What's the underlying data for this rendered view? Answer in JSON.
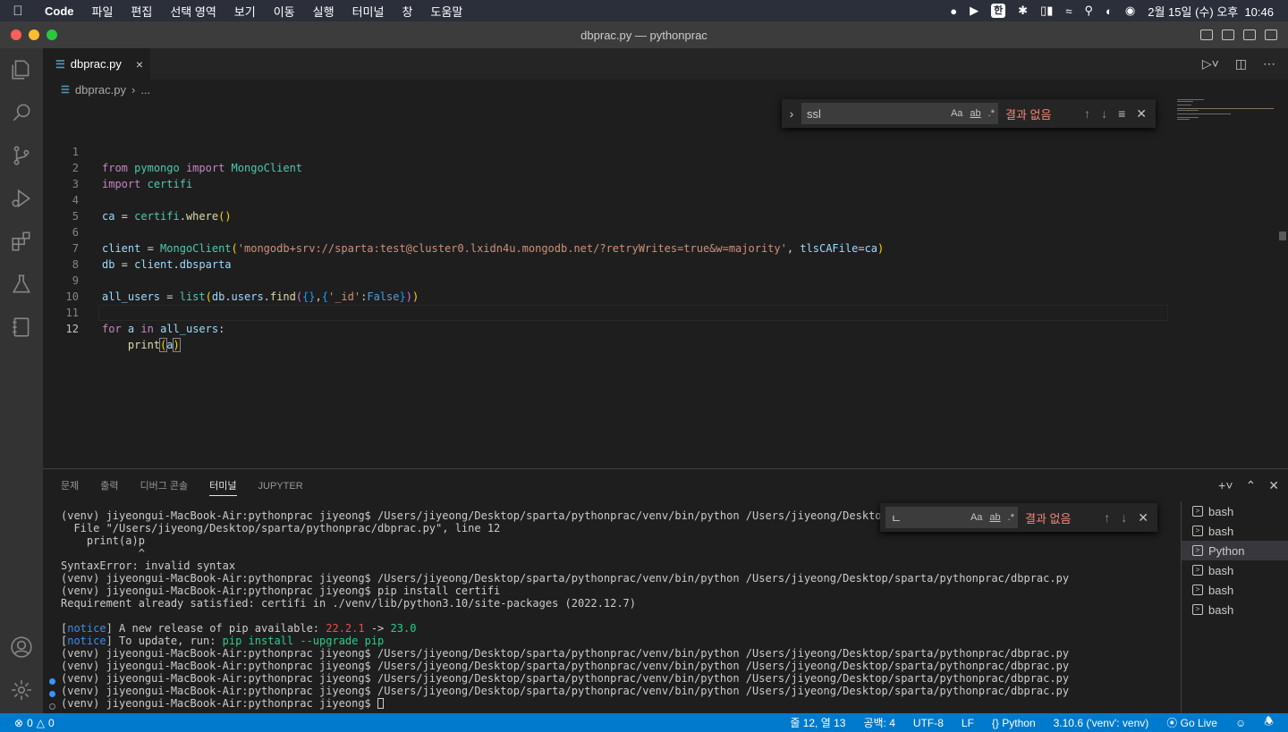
{
  "menubar": {
    "app": "Code",
    "items": [
      "파일",
      "편집",
      "선택 영역",
      "보기",
      "이동",
      "실행",
      "터미널",
      "창",
      "도움말"
    ],
    "input_method": "한",
    "datetime": "2월 15일 (수) 오후  10:46"
  },
  "window": {
    "title": "dbprac.py — pythonprac"
  },
  "tab": {
    "icon": "python-icon",
    "label": "dbprac.py",
    "close": "×"
  },
  "breadcrumb": {
    "file": "dbprac.py",
    "sep": "›",
    "more": "..."
  },
  "find": {
    "value": "ssl",
    "match_case": "Aa",
    "whole_word": "ab",
    "regex": ".*",
    "no_results": "결과 없음"
  },
  "code": {
    "active_line": 12,
    "lines": [
      {
        "n": "1"
      },
      {
        "n": "2"
      },
      {
        "n": "3"
      },
      {
        "n": "4"
      },
      {
        "n": "5"
      },
      {
        "n": "6"
      },
      {
        "n": "7"
      },
      {
        "n": "8"
      },
      {
        "n": "9"
      },
      {
        "n": "10"
      },
      {
        "n": "11"
      },
      {
        "n": "12"
      }
    ],
    "tokens": {
      "from": "from",
      "pymongo": "pymongo",
      "import": "import",
      "MongoClient": "MongoClient",
      "certifi": "certifi",
      "ca": "ca",
      "eq": " = ",
      "where": "where",
      "dot": ".",
      "paren_open": "(",
      "paren_close": ")",
      "client": "client",
      "conn_str": "'mongodb+srv://sparta:test@cluster0.lxidn4u.mongodb.net/?retryWrites=true&w=majority'",
      "comma_space": ", ",
      "tlsCAFile": "tlsCAFile",
      "assign": "=",
      "db": "db",
      "dbsparta": "dbsparta",
      "all_users": "all_users",
      "list": "list",
      "users": "users",
      "find": "find",
      "brace_open": "{",
      "brace_close": "}",
      "comma": ",",
      "id_key": "'_id'",
      "colon": ":",
      "False": "False",
      "for": "for",
      "a": "a",
      "in": "in",
      "print": "print",
      "indent": "    "
    }
  },
  "panel": {
    "tabs": [
      "문제",
      "출력",
      "디버그 콘솔",
      "터미널",
      "JUPYTER"
    ],
    "active_tab": "터미널",
    "find": {
      "value": "ㄴ",
      "no_results": "결과 없음"
    }
  },
  "terminal": {
    "lines": [
      "(venv) jiyeongui-MacBook-Air:pythonprac jiyeong$ /Users/jiyeong/Desktop/sparta/pythonprac/venv/bin/python /Users/jiyeong/Desktop/sp",
      "  File \"/Users/jiyeong/Desktop/sparta/pythonprac/dbprac.py\", line 12",
      "    print(a)p",
      "            ^",
      "SyntaxError: invalid syntax",
      "(venv) jiyeongui-MacBook-Air:pythonprac jiyeong$ /Users/jiyeong/Desktop/sparta/pythonprac/venv/bin/python /Users/jiyeong/Desktop/sparta/pythonprac/dbprac.py",
      "(venv) jiyeongui-MacBook-Air:pythonprac jiyeong$ pip install certifi",
      "Requirement already satisfied: certifi in ./venv/lib/python3.10/site-packages (2022.12.7)",
      "",
      "(venv) jiyeongui-MacBook-Air:pythonprac jiyeong$ /Users/jiyeong/Desktop/sparta/pythonprac/venv/bin/python /Users/jiyeong/Desktop/sparta/pythonprac/dbprac.py",
      "(venv) jiyeongui-MacBook-Air:pythonprac jiyeong$ /Users/jiyeong/Desktop/sparta/pythonprac/venv/bin/python /Users/jiyeong/Desktop/sparta/pythonprac/dbprac.py",
      "(venv) jiyeongui-MacBook-Air:pythonprac jiyeong$ /Users/jiyeong/Desktop/sparta/pythonprac/venv/bin/python /Users/jiyeong/Desktop/sparta/pythonprac/dbprac.py",
      "(venv) jiyeongui-MacBook-Air:pythonprac jiyeong$ /Users/jiyeong/Desktop/sparta/pythonprac/venv/bin/python /Users/jiyeong/Desktop/sparta/pythonprac/dbprac.py",
      "(venv) jiyeongui-MacBook-Air:pythonprac jiyeong$ "
    ],
    "notice1": {
      "tag": "notice",
      "text": " A new release of pip available: ",
      "old": "22.2.1",
      "arrow": " -> ",
      "new": "23.0"
    },
    "notice2": {
      "tag": "notice",
      "text": " To update, run: ",
      "cmd": "pip install --upgrade pip"
    },
    "shells": [
      "bash",
      "bash",
      "Python",
      "bash",
      "bash",
      "bash"
    ],
    "selected_shell": "Python"
  },
  "statusbar": {
    "errors": "0",
    "warnings": "0",
    "position": "줄 12, 열 13",
    "spaces": "공백: 4",
    "encoding": "UTF-8",
    "eol": "LF",
    "language": "Python",
    "interpreter": "3.10.6 ('venv': venv)",
    "golive": "Go Live"
  },
  "colors": {
    "accent": "#007acc",
    "error_text": "#f48771",
    "keyword": "#c586c0",
    "string": "#ce9178"
  }
}
